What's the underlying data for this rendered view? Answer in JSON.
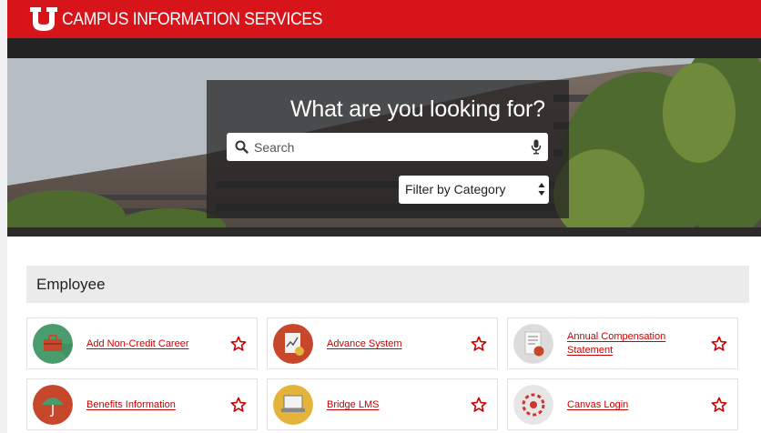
{
  "header": {
    "site_title": "CAMPUS INFORMATION SERVICES",
    "brand_color": "#d8141b"
  },
  "hero": {
    "heading": "What are you looking for?",
    "search": {
      "placeholder": "Search",
      "value": ""
    },
    "filter": {
      "selected": "Filter by Category"
    }
  },
  "section": {
    "title": "Employee",
    "cards": [
      {
        "label": "Add Non-Credit Career",
        "icon": "toolbox-icon",
        "icon_color": "#4a9c6d"
      },
      {
        "label": "Advance System",
        "icon": "chart-document-icon",
        "icon_color": "#c7472a"
      },
      {
        "label_line1": "Annual Compensation",
        "label_line2": "Statement",
        "icon": "statement-document-icon",
        "icon_color": "#dcdcdc"
      },
      {
        "label": "Benefits Information",
        "icon": "umbrella-icon",
        "icon_color": "#c7472a"
      },
      {
        "label": "Bridge LMS",
        "icon": "lms-laptop-icon",
        "icon_color": "#e3b33a"
      },
      {
        "label": "Canvas Login",
        "icon": "canvas-logo-icon",
        "icon_color": "#e6e6e6"
      }
    ]
  }
}
